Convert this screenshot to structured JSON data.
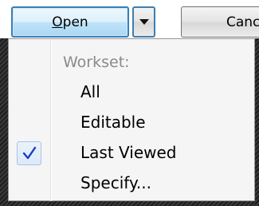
{
  "buttons": {
    "open_label_prefix": "O",
    "open_label_rest": "pen",
    "cancel_label": "Canc"
  },
  "icons": {
    "dropdown": "chevron-down-icon",
    "checkmark": "checkmark-icon"
  },
  "colors": {
    "focus_border": "#3c7fb1",
    "check_color": "#1a3cc8"
  },
  "menu": {
    "header": "Workset:",
    "items": [
      {
        "label": "All",
        "checked": false
      },
      {
        "label": "Editable",
        "checked": false
      },
      {
        "label": "Last Viewed",
        "checked": true
      },
      {
        "label": "Specify...",
        "checked": false
      }
    ]
  }
}
